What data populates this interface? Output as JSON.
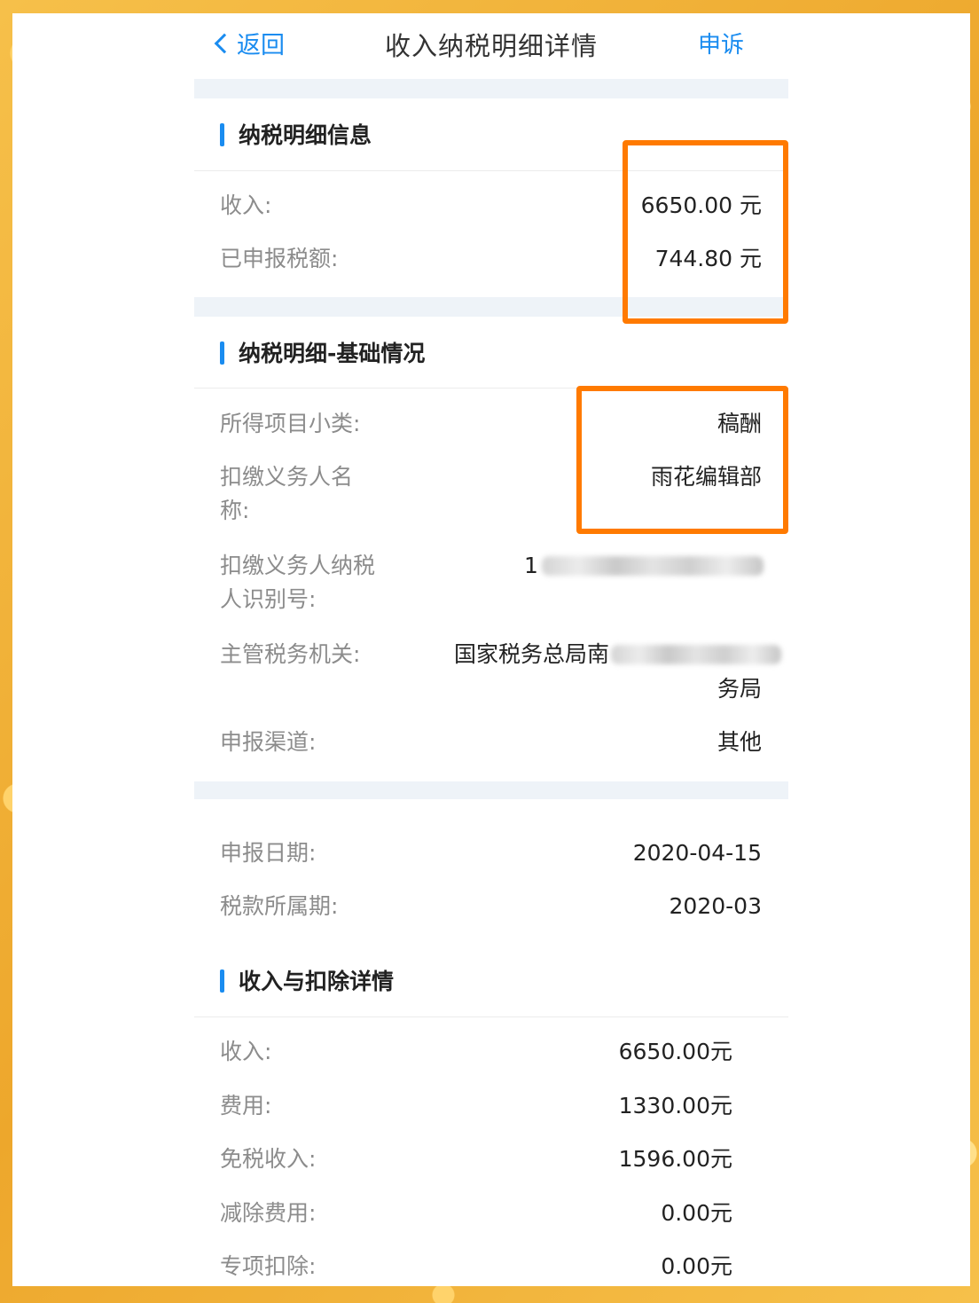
{
  "header": {
    "back_label": "返回",
    "title": "收入纳税明细详情",
    "appeal_label": "申诉"
  },
  "section1": {
    "title": "纳税明细信息",
    "rows": [
      {
        "label": "收入:",
        "value": "6650.00 元"
      },
      {
        "label": "已申报税额:",
        "value": "744.80 元"
      }
    ]
  },
  "section2": {
    "title": "纳税明细-基础情况",
    "subcategory_label": "所得项目小类:",
    "subcategory_value": "稿酬",
    "withholder_name_label_1": "扣缴义务人名",
    "withholder_name_label_2": "称:",
    "withholder_name_value": "雨花编辑部",
    "taxpayer_id_label_1": "扣缴义务人纳税",
    "taxpayer_id_label_2": "人识别号:",
    "taxpayer_id_visible": "1",
    "authority_label": "主管税务机关:",
    "authority_value_1": "国家税务总局南",
    "authority_value_2": "务局",
    "channel_label": "申报渠道:",
    "channel_value": "其他"
  },
  "section3": {
    "rows": [
      {
        "label": "申报日期:",
        "value": "2020-04-15"
      },
      {
        "label": "税款所属期:",
        "value": "2020-03"
      }
    ]
  },
  "section4": {
    "title": "收入与扣除详情",
    "rows": [
      {
        "label": "收入:",
        "value": "6650.00元"
      },
      {
        "label": "费用:",
        "value": "1330.00元"
      },
      {
        "label": "免税收入:",
        "value": "1596.00元"
      },
      {
        "label": "减除费用:",
        "value": "0.00元"
      },
      {
        "label": "专项扣除:",
        "value": "0.00元"
      }
    ]
  },
  "colors": {
    "accent": "#1a8cf0",
    "highlight": "#ff7a00",
    "frame": "#f2b53c"
  }
}
